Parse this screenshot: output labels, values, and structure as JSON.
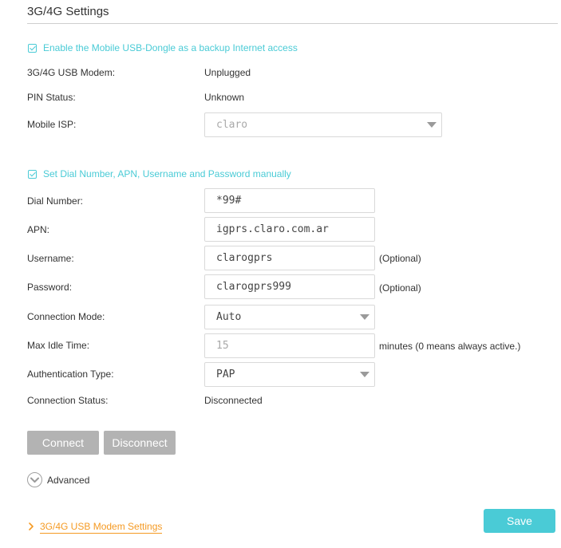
{
  "page": {
    "title": "3G/4G Settings"
  },
  "backup": {
    "checkbox_label": "Enable the Mobile USB-Dongle as a backup Internet access",
    "checked": true
  },
  "modem": {
    "label": "3G/4G USB Modem:",
    "value": "Unplugged"
  },
  "pin": {
    "label": "PIN Status:",
    "value": "Unknown"
  },
  "isp": {
    "label": "Mobile ISP:",
    "value": "claro"
  },
  "manual": {
    "checkbox_label": "Set Dial Number, APN, Username and Password manually",
    "checked": true
  },
  "dial": {
    "label": "Dial Number:",
    "value": "*99#"
  },
  "apn": {
    "label": "APN:",
    "value": "igprs.claro.com.ar"
  },
  "username": {
    "label": "Username:",
    "value": "clarogprs",
    "hint": "(Optional)"
  },
  "password": {
    "label": "Password:",
    "value": "clarogprs999",
    "hint": "(Optional)"
  },
  "conn_mode": {
    "label": "Connection Mode:",
    "value": "Auto"
  },
  "idle": {
    "label": "Max Idle Time:",
    "value": "15",
    "hint": "minutes (0 means always active.)"
  },
  "auth": {
    "label": "Authentication Type:",
    "value": "PAP"
  },
  "conn_status": {
    "label": "Connection Status:",
    "value": "Disconnected"
  },
  "buttons": {
    "connect": "Connect",
    "disconnect": "Disconnect",
    "save": "Save"
  },
  "advanced": {
    "label": "Advanced"
  },
  "footer": {
    "link": "3G/4G USB Modem Settings"
  },
  "colors": {
    "accent": "#4acbd6",
    "link": "#f59a23",
    "button_gray": "#b3b3b3"
  },
  "icons": {
    "checkbox": "checkmark-icon",
    "dropdown": "caret-down-icon",
    "advanced": "chevron-down-circle-icon",
    "footer": "chevron-right-icon"
  }
}
